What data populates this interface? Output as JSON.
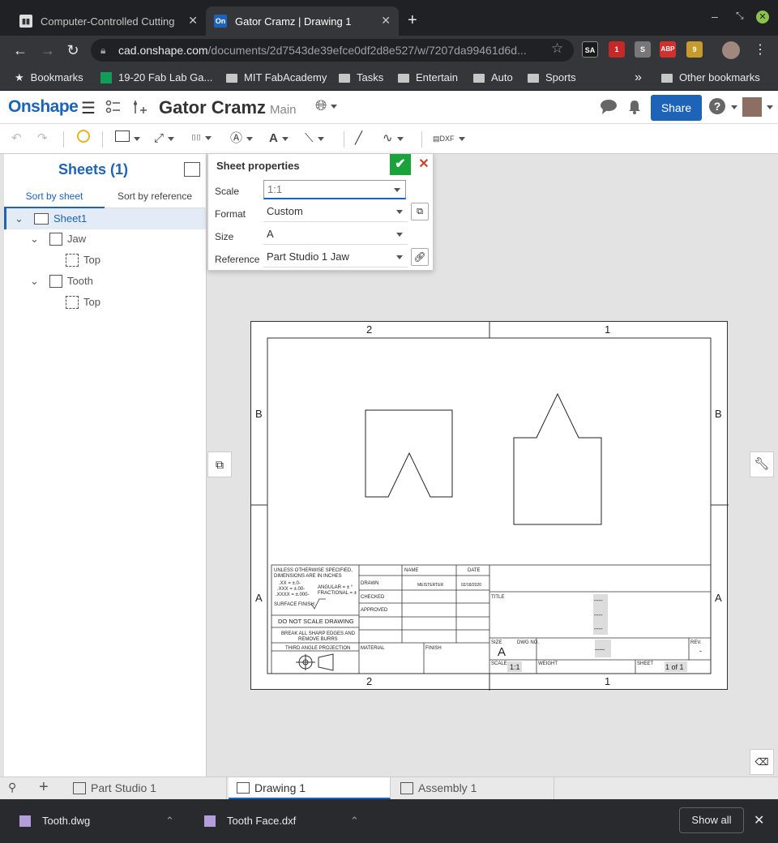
{
  "browser": {
    "tabs": [
      {
        "title": "Computer-Controlled Cutting",
        "favicon": "book-icon"
      },
      {
        "title": "Gator Cramz | Drawing 1",
        "favicon": "On"
      }
    ],
    "url_host": "cad.onshape.com",
    "url_path": "/documents/2d7543de39efce0df2d8e527/w/7207da99461d6d...",
    "extensions": [
      {
        "label": "SA"
      },
      {
        "label": "1"
      },
      {
        "label": "S"
      },
      {
        "label": "ABP"
      },
      {
        "label": "9"
      }
    ],
    "bookmarks": [
      "Bookmarks",
      "19-20 Fab Lab Ga...",
      "MIT FabAcademy",
      "Tasks",
      "Entertain",
      "Auto",
      "Sports"
    ],
    "more_bookmarks": "»",
    "other_bookmarks": "Other bookmarks"
  },
  "app": {
    "logo": "Onshape",
    "doc_title": "Gator Cramz",
    "branch": "Main",
    "share_label": "Share",
    "help_label": "?"
  },
  "left_panel": {
    "title": "Sheets (1)",
    "sort_tabs": [
      "Sort by sheet",
      "Sort by reference"
    ],
    "tree": [
      {
        "label": "Sheet1",
        "level": 0,
        "expanded": true,
        "selected": true
      },
      {
        "label": "Jaw",
        "level": 1,
        "expanded": true
      },
      {
        "label": "Top",
        "level": 2
      },
      {
        "label": "Tooth",
        "level": 1,
        "expanded": true
      },
      {
        "label": "Top",
        "level": 2
      }
    ]
  },
  "sheet_properties": {
    "title": "Sheet properties",
    "scale_label": "Scale",
    "scale_value": "1:1",
    "format_label": "Format",
    "format_value": "Custom",
    "size_label": "Size",
    "size_value": "A",
    "reference_label": "Reference",
    "reference_value": "Part Studio 1 Jaw"
  },
  "drawing": {
    "zones_top": [
      "2",
      "1"
    ],
    "zones_bottom": [
      "2",
      "1"
    ],
    "zones_side": [
      "B",
      "A"
    ],
    "title_block": {
      "unless": "UNLESS OTHERWISE SPECIFIED,",
      "dims": "DIMENSIONS ARE IN INCHES",
      "tol1": ".XX = ±.0-",
      "tol2": ".XXX = ±.00-",
      "tol3": ".XXXX = ±.000-",
      "angular": "ANGULAR = ± °",
      "fractional": "FRACTIONAL = ±",
      "surface": "SURFACE FINISH:",
      "noscale": "DO NOT SCALE DRAWING",
      "burrs1": "BREAK ALL SHARP EDGES AND",
      "burrs2": "REMOVE BURRS",
      "projection": "THIRD ANGLE PROJECTION",
      "name_hdr": "NAME",
      "date_hdr": "DATE",
      "drawn": "DRAWN",
      "drawn_name": "MEISTERTER",
      "drawn_date": "02/18/2020",
      "checked": "CHECKED",
      "approved": "APPROVED",
      "material": "MATERIAL",
      "finish": "FINISH",
      "title": "TITLE",
      "dashes": "----",
      "size_lbl": "SIZE",
      "size_val": "A",
      "dwg_lbl": "DWG NO.",
      "rev_lbl": "REV.",
      "rev_val": "-",
      "scale_lbl": "SCALE",
      "scale_val": "1:1",
      "weight_lbl": "WEIGHT",
      "sheet_lbl": "SHEET",
      "sheet_val": "1 of 1"
    }
  },
  "bottom_tabs": [
    {
      "label": "Part Studio 1",
      "active": false
    },
    {
      "label": "Drawing 1",
      "active": true
    },
    {
      "label": "Assembly 1",
      "active": false
    }
  ],
  "downloads": [
    {
      "name": "Tooth.dwg"
    },
    {
      "name": "Tooth Face.dxf"
    }
  ],
  "show_all": "Show all",
  "colors": {
    "accent": "#1d63b7",
    "confirm": "#1aa33a",
    "cancel": "#d0432a"
  }
}
